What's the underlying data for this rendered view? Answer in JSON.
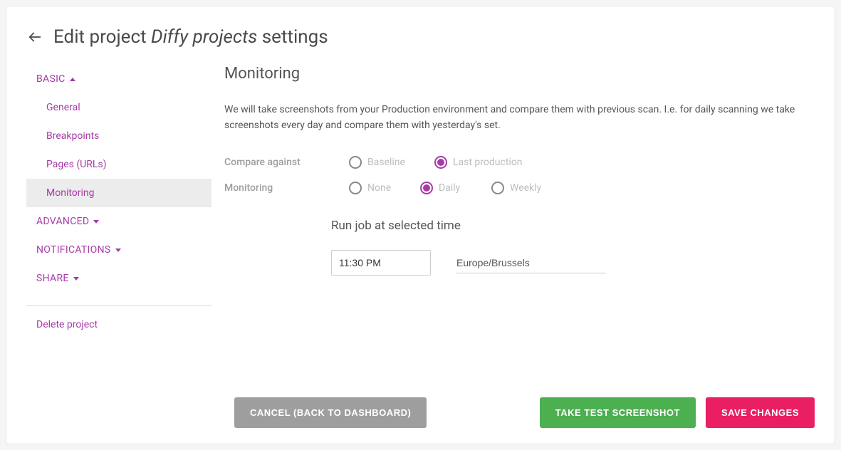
{
  "header": {
    "title_prefix": "Edit project ",
    "title_italic": "Diffy projects",
    "title_suffix": " settings"
  },
  "sidebar": {
    "sections": {
      "basic": {
        "label": "Basic",
        "expanded": true
      },
      "advanced": {
        "label": "Advanced"
      },
      "notifications": {
        "label": "Notifications"
      },
      "share": {
        "label": "Share"
      }
    },
    "basic_items": [
      {
        "label": "General"
      },
      {
        "label": "Breakpoints"
      },
      {
        "label": "Pages (URLs)"
      },
      {
        "label": "Monitoring",
        "active": true
      }
    ],
    "delete": "Delete project"
  },
  "main": {
    "heading": "Monitoring",
    "description": "We will take screenshots from your Production environment and compare them with previous scan. I.e. for daily scanning we take screenshots every day and compare them with yesterday's set.",
    "compare_label": "Compare against",
    "compare_options": {
      "baseline": "Baseline",
      "last_production": "Last production"
    },
    "compare_selected": "last_production",
    "monitoring_label": "Monitoring",
    "monitoring_options": {
      "none": "None",
      "daily": "Daily",
      "weekly": "Weekly"
    },
    "monitoring_selected": "daily",
    "run_job_heading": "Run job at selected time",
    "time_value": "11:30 PM",
    "timezone": "Europe/Brussels"
  },
  "footer": {
    "cancel": "Cancel (back to dashboard)",
    "test": "Take test screenshot",
    "save": "Save changes"
  }
}
